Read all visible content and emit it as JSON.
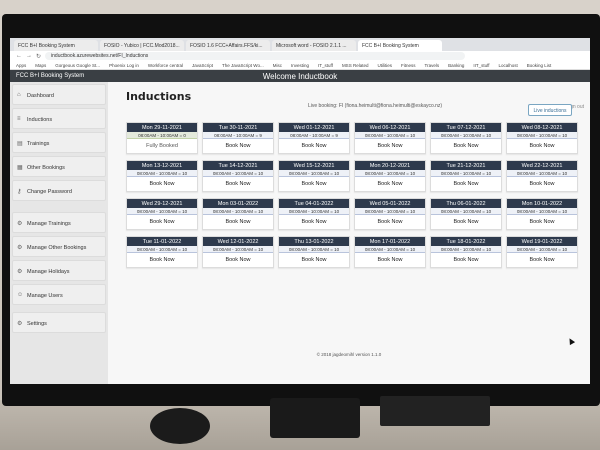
{
  "browser": {
    "tabs": [
      {
        "title": "FCC B+I Booking System",
        "active": false
      },
      {
        "title": "FOSIO - Yubico | FCC.Mod2018...",
        "active": false
      },
      {
        "title": "FOSIO 1.6 FCC+Affairs.FFS/ki...",
        "active": false
      },
      {
        "title": "Microsoft word - FOSIO 2.1.1 ...",
        "active": false
      },
      {
        "title": "FCC B+I Booking System",
        "active": true
      }
    ],
    "url": "inductbook.azurewebsites.net/FI_Inductions",
    "bookmarks": [
      "Apps",
      "Maps",
      "Gorgeous Google St...",
      "Phoenix Log in",
      "Workforce central",
      "JavaScript",
      "The JavaScript Wo...",
      "Misc",
      "Investing",
      "IT_stuff",
      "MSS Related",
      "Utilities",
      "Fitness",
      "Travels",
      "Banking",
      "IIT_stuff",
      "Localhost",
      "Booking List"
    ]
  },
  "app": {
    "brand": "FCC B+I Booking System",
    "welcome": "Welcome Inductbook",
    "signout": "Sign out"
  },
  "sidebar": {
    "items": [
      {
        "label": "Dashboard",
        "icon": "home-icon"
      },
      {
        "label": "Inductions",
        "icon": "list-icon"
      },
      {
        "label": "Trainings",
        "icon": "book-icon"
      },
      {
        "label": "Other Bookings",
        "icon": "calendar-icon"
      },
      {
        "label": "Change Password",
        "icon": "key-icon"
      },
      {
        "label": "Manage Trainings",
        "icon": "cog-icon"
      },
      {
        "label": "Manage Other Bookings",
        "icon": "cog-icon"
      },
      {
        "label": "Manage Holidays",
        "icon": "cog-icon"
      },
      {
        "label": "Manage Users",
        "icon": "users-icon"
      },
      {
        "label": "Settings",
        "icon": "settings-icon"
      }
    ],
    "utilities_label": "UTILITIES",
    "utilities_toggle": "+"
  },
  "main": {
    "title": "Inductions",
    "live_booking": "Live booking: FI (fiona.heimulti@fiona.heimulti@eskayco.nz)",
    "live_button": "Live inductions",
    "copyright": "© 2018 jagdeomihl version 1.1.0"
  },
  "cards": [
    {
      "date": "Mon 29-11-2021",
      "time": "08:00AM - 10:00AM = 0",
      "action": "Fully Booked",
      "booked": true
    },
    {
      "date": "Tue 30-11-2021",
      "time": "08:00AM - 10:00AM = 9",
      "action": "Book Now",
      "booked": false
    },
    {
      "date": "Wed 01-12-2021",
      "time": "08:00AM - 10:00AM = 9",
      "action": "Book Now",
      "booked": false
    },
    {
      "date": "Wed 06-12-2021",
      "time": "08:00AM - 10:00AM = 10",
      "action": "Book Now",
      "booked": false
    },
    {
      "date": "Tue 07-12-2021",
      "time": "08:00AM - 10:00AM = 10",
      "action": "Book Now",
      "booked": false
    },
    {
      "date": "Wed 08-12-2021",
      "time": "08:00AM - 10:00AM = 10",
      "action": "Book Now",
      "booked": false
    },
    {
      "date": "Mon 13-12-2021",
      "time": "08:00AM - 10:00AM = 10",
      "action": "Book Now",
      "booked": false
    },
    {
      "date": "Tue 14-12-2021",
      "time": "08:00AM - 10:00AM = 10",
      "action": "Book Now",
      "booked": false
    },
    {
      "date": "Wed 15-12-2021",
      "time": "08:00AM - 10:00AM = 10",
      "action": "Book Now",
      "booked": false
    },
    {
      "date": "Mon 20-12-2021",
      "time": "08:00AM - 10:00AM = 10",
      "action": "Book Now",
      "booked": false
    },
    {
      "date": "Tue 21-12-2021",
      "time": "08:00AM - 10:00AM = 10",
      "action": "Book Now",
      "booked": false
    },
    {
      "date": "Wed 22-12-2021",
      "time": "08:00AM - 10:00AM = 10",
      "action": "Book Now",
      "booked": false
    },
    {
      "date": "Wed 29-12-2021",
      "time": "08:00AM - 10:00AM = 10",
      "action": "Book Now",
      "booked": false
    },
    {
      "date": "Mon 03-01-2022",
      "time": "08:00AM - 10:00AM = 10",
      "action": "Book Now",
      "booked": false
    },
    {
      "date": "Tue 04-01-2022",
      "time": "08:00AM - 10:00AM = 10",
      "action": "Book Now",
      "booked": false
    },
    {
      "date": "Wed 05-01-2022",
      "time": "08:00AM - 10:00AM = 10",
      "action": "Book Now",
      "booked": false
    },
    {
      "date": "Thu 06-01-2022",
      "time": "08:00AM - 10:00AM = 10",
      "action": "Book Now",
      "booked": false
    },
    {
      "date": "Mon 10-01-2022",
      "time": "08:00AM - 10:00AM = 10",
      "action": "Book Now",
      "booked": false
    },
    {
      "date": "Tue 11-01-2022",
      "time": "08:00AM - 10:00AM = 10",
      "action": "Book Now",
      "booked": false
    },
    {
      "date": "Wed 12-01-2022",
      "time": "08:00AM - 10:00AM = 10",
      "action": "Book Now",
      "booked": false
    },
    {
      "date": "Thu 13-01-2022",
      "time": "08:00AM - 10:00AM = 10",
      "action": "Book Now",
      "booked": false
    },
    {
      "date": "Mon 17-01-2022",
      "time": "08:00AM - 10:00AM = 10",
      "action": "Book Now",
      "booked": false
    },
    {
      "date": "Tue 18-01-2022",
      "time": "08:00AM - 10:00AM = 10",
      "action": "Book Now",
      "booked": false
    },
    {
      "date": "Wed 19-01-2022",
      "time": "08:00AM - 10:00AM = 10",
      "action": "Book Now",
      "booked": false
    }
  ],
  "colors": {
    "header_bg": "#3a3f44",
    "card_head": "#2e3a4d",
    "sidebar_bg": "#e6e6e6",
    "accent": "#3b6f96"
  }
}
